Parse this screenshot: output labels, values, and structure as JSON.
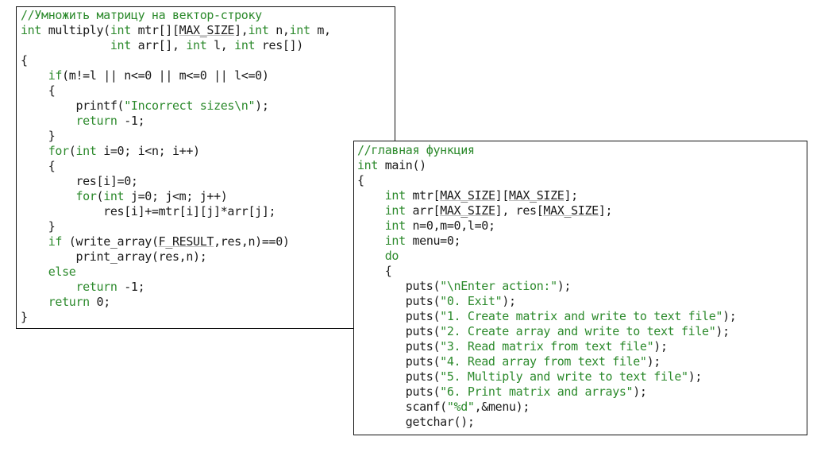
{
  "colors": {
    "keyword": "#2c8a2c",
    "comment": "#2c8a2c",
    "text": "#1a1a1a",
    "border": "#111111",
    "background": "#ffffff"
  },
  "left_panel": {
    "lines": [
      [
        [
          "comment",
          "//Умножить матрицу на вектор-строку"
        ]
      ],
      [
        [
          "keyword",
          "int"
        ],
        [
          "plain",
          " multiply("
        ],
        [
          "keyword",
          "int"
        ],
        [
          "plain",
          " mtr[]["
        ],
        [
          "macro",
          "MAX_SIZE"
        ],
        [
          "plain",
          "],"
        ],
        [
          "keyword",
          "int"
        ],
        [
          "plain",
          " n,"
        ],
        [
          "keyword",
          "int"
        ],
        [
          "plain",
          " m,"
        ]
      ],
      [
        [
          "plain",
          "             "
        ],
        [
          "keyword",
          "int"
        ],
        [
          "plain",
          " arr[], "
        ],
        [
          "keyword",
          "int"
        ],
        [
          "plain",
          " l, "
        ],
        [
          "keyword",
          "int"
        ],
        [
          "plain",
          " res[])"
        ]
      ],
      [
        [
          "plain",
          "{"
        ]
      ],
      [
        [
          "plain",
          "    "
        ],
        [
          "keyword",
          "if"
        ],
        [
          "plain",
          "(m!=l || n<=0 || m<=0 || l<=0)"
        ]
      ],
      [
        [
          "plain",
          "    {"
        ]
      ],
      [
        [
          "plain",
          "        printf("
        ],
        [
          "keyword",
          "\"Incorrect sizes\\n\""
        ],
        [
          "plain",
          ");"
        ]
      ],
      [
        [
          "plain",
          "        "
        ],
        [
          "keyword",
          "return"
        ],
        [
          "plain",
          " -1;"
        ]
      ],
      [
        [
          "plain",
          "    }"
        ]
      ],
      [
        [
          "plain",
          "    "
        ],
        [
          "keyword",
          "for"
        ],
        [
          "plain",
          "("
        ],
        [
          "keyword",
          "int"
        ],
        [
          "plain",
          " i=0; i<n; i++)"
        ]
      ],
      [
        [
          "plain",
          "    {"
        ]
      ],
      [
        [
          "plain",
          "        res[i]=0;"
        ]
      ],
      [
        [
          "plain",
          "        "
        ],
        [
          "keyword",
          "for"
        ],
        [
          "plain",
          "("
        ],
        [
          "keyword",
          "int"
        ],
        [
          "plain",
          " j=0; j<m; j++)"
        ]
      ],
      [
        [
          "plain",
          "            res[i]+=mtr[i][j]*arr[j];"
        ]
      ],
      [
        [
          "plain",
          "    }"
        ]
      ],
      [
        [
          "plain",
          "    "
        ],
        [
          "keyword",
          "if"
        ],
        [
          "plain",
          " (write_array("
        ],
        [
          "macro",
          "F_RESULT"
        ],
        [
          "plain",
          ",res,n)==0)"
        ]
      ],
      [
        [
          "plain",
          "        print_array(res,n);"
        ]
      ],
      [
        [
          "plain",
          "    "
        ],
        [
          "keyword",
          "else"
        ]
      ],
      [
        [
          "plain",
          "        "
        ],
        [
          "keyword",
          "return"
        ],
        [
          "plain",
          " -1;"
        ]
      ],
      [
        [
          "plain",
          "    "
        ],
        [
          "keyword",
          "return"
        ],
        [
          "plain",
          " 0;"
        ]
      ],
      [
        [
          "plain",
          "}"
        ]
      ]
    ]
  },
  "right_panel": {
    "lines": [
      [
        [
          "comment",
          "//главная функция"
        ]
      ],
      [
        [
          "keyword",
          "int"
        ],
        [
          "plain",
          " main()"
        ]
      ],
      [
        [
          "plain",
          "{"
        ]
      ],
      [
        [
          "plain",
          "    "
        ],
        [
          "keyword",
          "int"
        ],
        [
          "plain",
          " mtr["
        ],
        [
          "macro",
          "MAX_SIZE"
        ],
        [
          "plain",
          "]["
        ],
        [
          "macro",
          "MAX_SIZE"
        ],
        [
          "plain",
          "];"
        ]
      ],
      [
        [
          "plain",
          "    "
        ],
        [
          "keyword",
          "int"
        ],
        [
          "plain",
          " arr["
        ],
        [
          "macro",
          "MAX_SIZE"
        ],
        [
          "plain",
          "], res["
        ],
        [
          "macro",
          "MAX_SIZE"
        ],
        [
          "plain",
          "];"
        ]
      ],
      [
        [
          "plain",
          "    "
        ],
        [
          "keyword",
          "int"
        ],
        [
          "plain",
          " n=0,m=0,l=0;"
        ]
      ],
      [
        [
          "plain",
          "    "
        ],
        [
          "keyword",
          "int"
        ],
        [
          "plain",
          " menu=0;"
        ]
      ],
      [
        [
          "plain",
          "    "
        ],
        [
          "keyword",
          "do"
        ]
      ],
      [
        [
          "plain",
          "    {"
        ]
      ],
      [
        [
          "plain",
          "       puts("
        ],
        [
          "keyword",
          "\"\\nEnter action:\""
        ],
        [
          "plain",
          ");"
        ]
      ],
      [
        [
          "plain",
          "       puts("
        ],
        [
          "keyword",
          "\"0. Exit\""
        ],
        [
          "plain",
          ");"
        ]
      ],
      [
        [
          "plain",
          "       puts("
        ],
        [
          "keyword",
          "\"1. Create matrix and write to text file\""
        ],
        [
          "plain",
          ");"
        ]
      ],
      [
        [
          "plain",
          "       puts("
        ],
        [
          "keyword",
          "\"2. Create array and write to text file\""
        ],
        [
          "plain",
          ");"
        ]
      ],
      [
        [
          "plain",
          "       puts("
        ],
        [
          "keyword",
          "\"3. Read matrix from text file\""
        ],
        [
          "plain",
          ");"
        ]
      ],
      [
        [
          "plain",
          "       puts("
        ],
        [
          "keyword",
          "\"4. Read array from text file\""
        ],
        [
          "plain",
          ");"
        ]
      ],
      [
        [
          "plain",
          "       puts("
        ],
        [
          "keyword",
          "\"5. Multiply and write to text file\""
        ],
        [
          "plain",
          ");"
        ]
      ],
      [
        [
          "plain",
          "       puts("
        ],
        [
          "keyword",
          "\"6. Print matrix and arrays\""
        ],
        [
          "plain",
          ");"
        ]
      ],
      [
        [
          "plain",
          "       scanf("
        ],
        [
          "keyword",
          "\"%d\""
        ],
        [
          "plain",
          ",&menu);"
        ]
      ],
      [
        [
          "plain",
          "       getchar();"
        ]
      ]
    ]
  }
}
